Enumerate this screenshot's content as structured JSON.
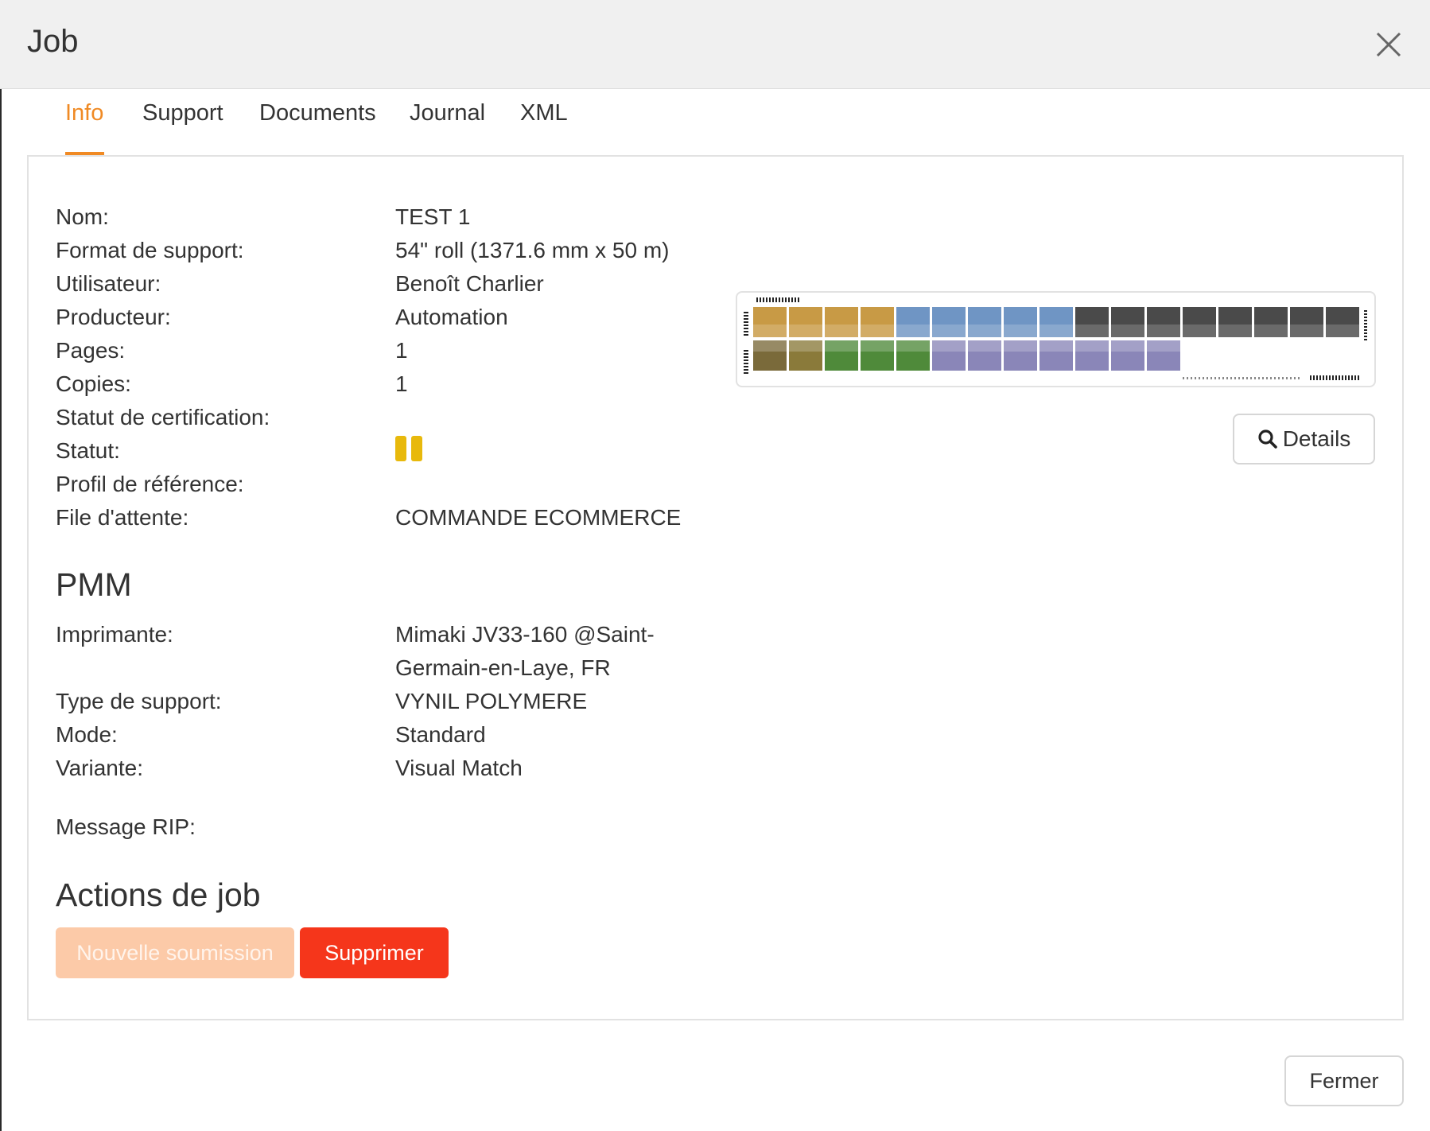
{
  "window": {
    "title": "Job"
  },
  "icons": {
    "close": "close-icon",
    "status": "pause-icon",
    "details": "search-icon"
  },
  "colors": {
    "accent": "#f08a24",
    "status_pause": "#e8b90c",
    "delete": "#f5361b",
    "resubmit_disabled": "#fccaa8"
  },
  "tabs": [
    {
      "label": "Info",
      "active": true
    },
    {
      "label": "Support",
      "active": false
    },
    {
      "label": "Documents",
      "active": false
    },
    {
      "label": "Journal",
      "active": false
    },
    {
      "label": "XML",
      "active": false
    }
  ],
  "info": {
    "rows": [
      {
        "label": "Nom:",
        "value": "TEST 1"
      },
      {
        "label": "Format de support:",
        "value": "54\" roll (1371.6 mm x 50 m)"
      },
      {
        "label": "Utilisateur:",
        "value": "Benoît Charlier"
      },
      {
        "label": "Producteur:",
        "value": "Automation"
      },
      {
        "label": "Pages:",
        "value": "1"
      },
      {
        "label": "Copies:",
        "value": "1"
      },
      {
        "label": "Statut de certification:",
        "value": ""
      },
      {
        "label": "Statut:",
        "value": ""
      },
      {
        "label": "Profil de référence:",
        "value": ""
      },
      {
        "label": "File d'attente:",
        "value": "COMMANDE ECOMMERCE"
      }
    ]
  },
  "preview": {
    "details_label": "Details"
  },
  "pmm": {
    "title": "PMM",
    "printer_label": "Imprimante:",
    "printer_value_line1": "Mimaki JV33-160 @Saint-",
    "printer_value_line2": "Germain-en-Laye, FR",
    "rows": [
      {
        "label": "Type de support:",
        "value": "VYNIL POLYMERE"
      },
      {
        "label": "Mode:",
        "value": "Standard"
      },
      {
        "label": "Variante:",
        "value": "Visual Match"
      }
    ],
    "rip_label": "Message RIP:"
  },
  "actions": {
    "title": "Actions de job",
    "resubmit_label": "Nouvelle soumission",
    "delete_label": "Supprimer"
  },
  "footer": {
    "close_label": "Fermer"
  }
}
